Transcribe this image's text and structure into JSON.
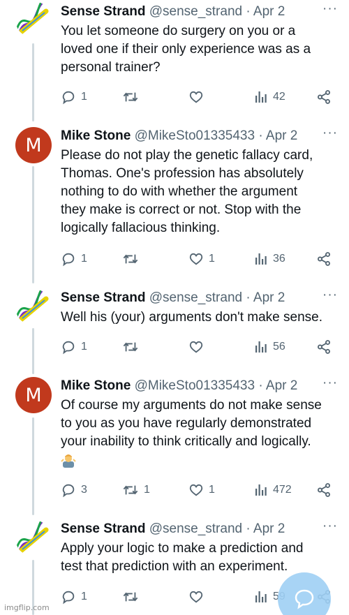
{
  "tweets": [
    {
      "name": "Sense Strand",
      "handle": "@sense_strand",
      "date": "· Apr 2",
      "text": [
        "You let someone do surgery on you or a",
        "loved one if their only experience was as a",
        "personal trainer?"
      ],
      "replies": "1",
      "retweets": "",
      "likes": "",
      "views": "42"
    },
    {
      "name": "Mike Stone",
      "handle": "@MikeSto01335433",
      "date": "· Apr 2",
      "avatar_letter": "M",
      "text": [
        "Please do not play the genetic fallacy card,",
        "Thomas. One's profession has absolutely",
        "nothing to do with whether the argument",
        "they make is correct or not. Stop with the",
        "logically fallacious thinking."
      ],
      "replies": "1",
      "retweets": "",
      "likes": "1",
      "views": "36"
    },
    {
      "name": "Sense Strand",
      "handle": "@sense_strand",
      "date": "· Apr 2",
      "text": [
        "Well his (your) arguments don't make sense."
      ],
      "replies": "1",
      "retweets": "",
      "likes": "",
      "views": "56"
    },
    {
      "name": "Mike Stone",
      "handle": "@MikeSto01335433",
      "date": "· Apr 2",
      "avatar_letter": "M",
      "text": [
        "Of course my arguments do not make sense",
        "to you as you have regularly demonstrated",
        "your inability to think critically and logically."
      ],
      "replies": "3",
      "retweets": "1",
      "likes": "1",
      "views": "472"
    },
    {
      "name": "Sense Strand",
      "handle": "@sense_strand",
      "date": "· Apr 2",
      "text": [
        "Apply your logic to make a prediction and",
        "test that prediction with an experiment."
      ],
      "replies": "1",
      "retweets": "",
      "likes": "",
      "views": "59"
    }
  ],
  "more_label": "···",
  "watermark": "imgflip.com",
  "colors": {
    "secondary": "#536471",
    "avatar_m": "#c1391d",
    "fab": "#9fd0f5",
    "thread_line": "#cfd9de"
  },
  "icons": [
    "reply-icon",
    "retweet-icon",
    "like-icon",
    "views-icon",
    "share-icon",
    "more-icon",
    "compose-icon",
    "shrug-emoji"
  ]
}
